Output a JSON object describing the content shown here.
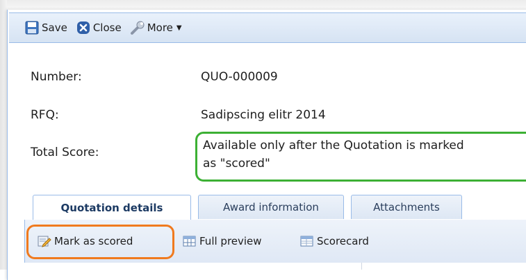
{
  "toolbar": {
    "save_label": "Save",
    "close_label": "Close",
    "more_label": "More"
  },
  "form": {
    "number_label": "Number:",
    "number_value": "QUO-000009",
    "rfq_label": "RFQ:",
    "rfq_value": "Sadipscing elitr 2014",
    "score_label": "Total Score:",
    "score_line1": "Available only after the Quotation is marked",
    "score_line2": "as \"scored\""
  },
  "tabs": [
    {
      "label": "Quotation details",
      "active": true
    },
    {
      "label": "Award information",
      "active": false
    },
    {
      "label": "Attachments",
      "active": false
    }
  ],
  "tab_toolbar": {
    "mark_scored_label": "Mark as scored",
    "full_preview_label": "Full preview",
    "scorecard_label": "Scorecard"
  },
  "colors": {
    "highlight_green": "#3cb034",
    "highlight_orange": "#f07a1e",
    "border_blue": "#99bbe8",
    "close_icon_blue": "#2f5fa8"
  }
}
